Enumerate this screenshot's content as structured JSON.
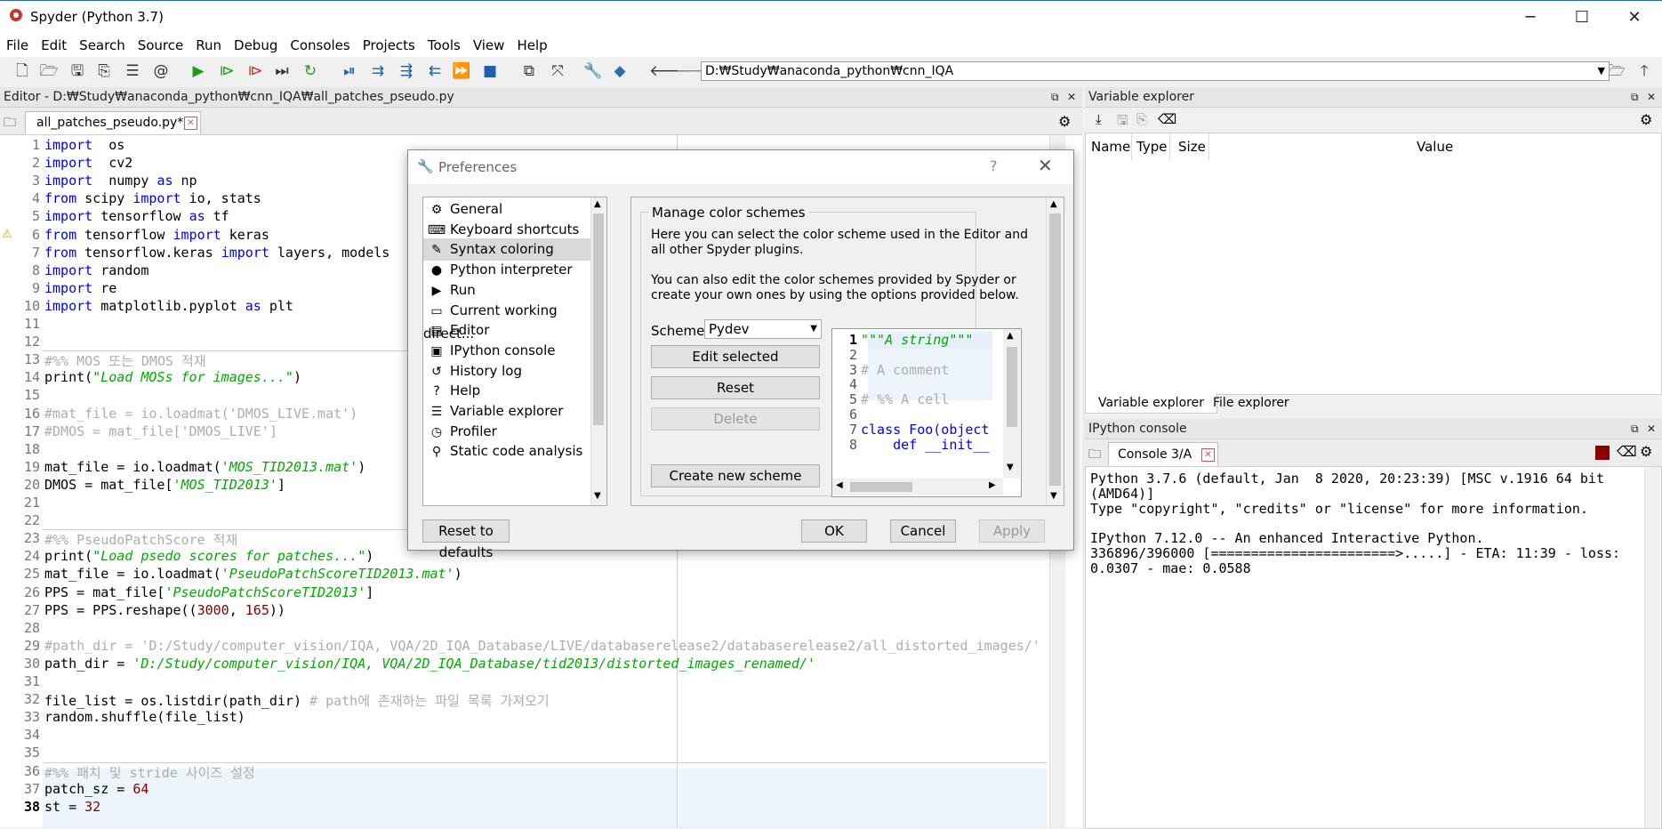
{
  "window": {
    "title": "Spyder (Python 3.7)"
  },
  "menu": [
    "File",
    "Edit",
    "Search",
    "Source",
    "Run",
    "Debug",
    "Consoles",
    "Projects",
    "Tools",
    "View",
    "Help"
  ],
  "toolbar": {
    "working_dir": "D:₩Study₩anaconda_python₩cnn_IQA"
  },
  "editor": {
    "header": "Editor - D:₩Study₩anaconda_python₩cnn_IQA₩all_patches_pseudo.py",
    "tab_label": "all_patches_pseudo.py*",
    "lines": [
      {
        "n": "1",
        "t": [
          [
            "kw",
            "import"
          ],
          [
            "",
            "  os"
          ]
        ]
      },
      {
        "n": "2",
        "t": [
          [
            "kw",
            "import"
          ],
          [
            "",
            "  cv2"
          ]
        ]
      },
      {
        "n": "3",
        "t": [
          [
            "kw",
            "import"
          ],
          [
            "",
            "  numpy "
          ],
          [
            "kw",
            "as"
          ],
          [
            "",
            " np"
          ]
        ]
      },
      {
        "n": "4",
        "t": [
          [
            "kw",
            "from"
          ],
          [
            "",
            " scipy "
          ],
          [
            "kw",
            "import"
          ],
          [
            "",
            " io, stats"
          ]
        ]
      },
      {
        "n": "5",
        "t": [
          [
            "kw",
            "import"
          ],
          [
            "",
            " tensorflow "
          ],
          [
            "kw",
            "as"
          ],
          [
            "",
            " tf"
          ]
        ]
      },
      {
        "n": "6",
        "t": [
          [
            "kw",
            "from"
          ],
          [
            "",
            " tensorflow "
          ],
          [
            "kw",
            "import"
          ],
          [
            "",
            " keras"
          ]
        ]
      },
      {
        "n": "7",
        "t": [
          [
            "kw",
            "from"
          ],
          [
            "",
            " tensorflow.keras "
          ],
          [
            "kw",
            "import"
          ],
          [
            "",
            " layers, models"
          ]
        ]
      },
      {
        "n": "8",
        "t": [
          [
            "kw",
            "import"
          ],
          [
            "",
            " random"
          ]
        ]
      },
      {
        "n": "9",
        "t": [
          [
            "kw",
            "import"
          ],
          [
            "",
            " re"
          ]
        ]
      },
      {
        "n": "10",
        "t": [
          [
            "kw",
            "import"
          ],
          [
            "",
            " matplotlib.pyplot "
          ],
          [
            "kw",
            "as"
          ],
          [
            "",
            " plt"
          ]
        ]
      },
      {
        "n": "11",
        "t": []
      },
      {
        "n": "12",
        "t": []
      },
      {
        "n": "13",
        "t": [
          [
            "cm",
            "#%% MOS 또는 DMOS 적재"
          ]
        ]
      },
      {
        "n": "14",
        "t": [
          [
            "",
            "print("
          ],
          [
            "str",
            "\"Load MOSs for images...\""
          ],
          [
            "",
            ")"
          ]
        ]
      },
      {
        "n": "15",
        "t": []
      },
      {
        "n": "16",
        "t": [
          [
            "cm",
            "#mat_file = io.loadmat('DMOS_LIVE.mat')"
          ]
        ]
      },
      {
        "n": "17",
        "t": [
          [
            "cm",
            "#DMOS = mat_file['DMOS_LIVE']"
          ]
        ]
      },
      {
        "n": "18",
        "t": []
      },
      {
        "n": "19",
        "t": [
          [
            "",
            "mat_file = io.loadmat("
          ],
          [
            "str",
            "'MOS_TID2013.mat'"
          ],
          [
            "",
            ")"
          ]
        ]
      },
      {
        "n": "20",
        "t": [
          [
            "",
            "DMOS = mat_file["
          ],
          [
            "str",
            "'MOS_TID2013'"
          ],
          [
            "",
            "]"
          ]
        ]
      },
      {
        "n": "21",
        "t": []
      },
      {
        "n": "22",
        "t": []
      },
      {
        "n": "23",
        "t": [
          [
            "cm",
            "#%% PseudoPatchScore 적재"
          ]
        ]
      },
      {
        "n": "24",
        "t": [
          [
            "",
            "print("
          ],
          [
            "str",
            "\"Load psedo scores for patches...\""
          ],
          [
            "",
            ")"
          ]
        ]
      },
      {
        "n": "25",
        "t": [
          [
            "",
            "mat_file = io.loadmat("
          ],
          [
            "str",
            "'PseudoPatchScoreTID2013.mat'"
          ],
          [
            "",
            ")"
          ]
        ]
      },
      {
        "n": "26",
        "t": [
          [
            "",
            "PPS = mat_file["
          ],
          [
            "str",
            "'PseudoPatchScoreTID2013'"
          ],
          [
            "",
            "]"
          ]
        ]
      },
      {
        "n": "27",
        "t": [
          [
            "",
            "PPS = PPS.reshape(("
          ],
          [
            "num",
            "3000"
          ],
          [
            "",
            ", "
          ],
          [
            "num",
            "165"
          ],
          [
            "",
            "))"
          ]
        ]
      },
      {
        "n": "28",
        "t": []
      },
      {
        "n": "29",
        "t": [
          [
            "cm",
            "#path_dir = 'D:/Study/computer_vision/IQA, VQA/2D_IQA_Database/LIVE/databaserelease2/databaserelease2/all_distorted_images/'"
          ]
        ]
      },
      {
        "n": "30",
        "t": [
          [
            "",
            "path_dir = "
          ],
          [
            "str",
            "'D:/Study/computer_vision/IQA, VQA/2D_IQA_Database/tid2013/distorted_images_renamed/'"
          ]
        ]
      },
      {
        "n": "31",
        "t": []
      },
      {
        "n": "32",
        "t": [
          [
            "",
            "file_list = os.listdir(path_dir) "
          ],
          [
            "cm",
            "# path에 존재하는 파일 목록 가져오기"
          ]
        ]
      },
      {
        "n": "33",
        "t": [
          [
            "",
            "random.shuffle(file_list)"
          ]
        ]
      },
      {
        "n": "34",
        "t": []
      },
      {
        "n": "35",
        "t": []
      },
      {
        "n": "36",
        "t": [
          [
            "cm",
            "#%% 패치 및 stride 사이즈 설정"
          ]
        ]
      },
      {
        "n": "37",
        "t": [
          [
            "",
            "patch_sz = "
          ],
          [
            "num",
            "64"
          ]
        ]
      },
      {
        "n": "38",
        "t": [
          [
            "",
            "st = "
          ],
          [
            "num",
            "32"
          ]
        ]
      }
    ]
  },
  "variable_explorer": {
    "header": "Variable explorer",
    "columns": [
      "Name",
      "Type",
      "Size",
      "Value"
    ],
    "tabs": [
      "Variable explorer",
      "File explorer"
    ]
  },
  "ipython": {
    "header": "IPython console",
    "tab_label": "Console 3/A",
    "lines": [
      "Python 3.7.6 (default, Jan  8 2020, 20:23:39) [MSC v.1916 64 bit",
      "(AMD64)]",
      "Type \"copyright\", \"credits\" or \"license\" for more information.",
      "",
      "IPython 7.12.0 -- An enhanced Interactive Python.",
      "336896/396000 [=======================>.....] - ETA: 11:39 - loss:",
      "0.0307 - mae: 0.0588"
    ]
  },
  "preferences": {
    "title": "Preferences",
    "help": "?",
    "categories": [
      {
        "label": "General",
        "icon": "⚙"
      },
      {
        "label": "Keyboard shortcuts",
        "icon": "⌨"
      },
      {
        "label": "Syntax coloring",
        "icon": "✎"
      },
      {
        "label": "Python interpreter",
        "icon": "●"
      },
      {
        "label": "Run",
        "icon": "▶"
      },
      {
        "label": "Current working direct...",
        "icon": "▭"
      },
      {
        "label": "Editor",
        "icon": "▤"
      },
      {
        "label": "IPython console",
        "icon": "▣"
      },
      {
        "label": "History log",
        "icon": "↺"
      },
      {
        "label": "Help",
        "icon": "?"
      },
      {
        "label": "Variable explorer",
        "icon": "☰"
      },
      {
        "label": "Profiler",
        "icon": "◷"
      },
      {
        "label": "Static code analysis",
        "icon": "⚲"
      }
    ],
    "group_title": "Manage color schemes",
    "desc1_a": "Here you can select the color scheme used in the Editor and",
    "desc1_b": "all other Spyder plugins.",
    "desc2_a": "You can also edit the color schemes provided by Spyder or",
    "desc2_b": "create your own ones by using the options provided below.",
    "scheme_label": "Scheme:",
    "scheme_value": "Pydev",
    "buttons": {
      "edit": "Edit selected",
      "reset": "Reset",
      "delete": "Delete",
      "create": "Create new scheme"
    },
    "preview": [
      {
        "n": "1",
        "t": "\"\"\"A string\"\"\"",
        "c": "str"
      },
      {
        "n": "2",
        "t": "",
        "c": ""
      },
      {
        "n": "3",
        "t": "# A comment",
        "c": "cm"
      },
      {
        "n": "4",
        "t": "",
        "c": ""
      },
      {
        "n": "5",
        "t": "# %% A cell",
        "c": "cm"
      },
      {
        "n": "6",
        "t": "",
        "c": ""
      },
      {
        "n": "7",
        "t": "class Foo(object",
        "c": "cls"
      },
      {
        "n": "8",
        "t": "    def __init__",
        "c": "def"
      }
    ],
    "footer": {
      "reset": "Reset to defaults",
      "ok": "OK",
      "cancel": "Cancel",
      "apply": "Apply"
    }
  },
  "colors": {
    "keyword": "#0000ff",
    "string": "#00aa00",
    "comment": "#adadad",
    "number": "#800000",
    "run": "#1a9e1a",
    "stop": "#8b0000"
  }
}
